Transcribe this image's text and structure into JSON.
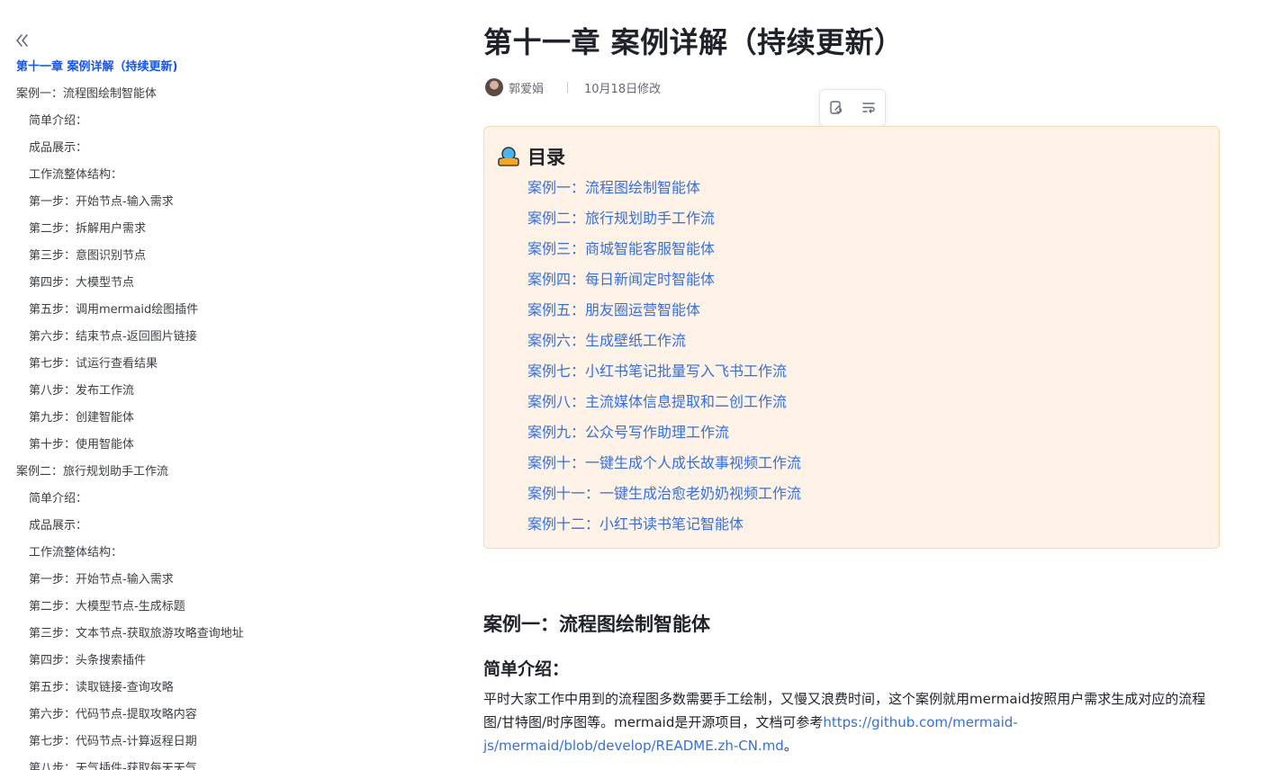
{
  "sidebar": {
    "items": [
      {
        "label": "第十一章 案例详解（持续更新)",
        "level": 1,
        "active": true
      },
      {
        "label": "案例一：流程图绘制智能体",
        "level": 1
      },
      {
        "label": "简单介绍：",
        "level": 2
      },
      {
        "label": "成品展示：",
        "level": 2
      },
      {
        "label": "工作流整体结构：",
        "level": 2
      },
      {
        "label": "第一步：开始节点-输入需求",
        "level": 2
      },
      {
        "label": "第二步：拆解用户需求",
        "level": 2
      },
      {
        "label": "第三步：意图识别节点",
        "level": 2
      },
      {
        "label": "第四步：大模型节点",
        "level": 2
      },
      {
        "label": "第五步：调用mermaid绘图插件",
        "level": 2
      },
      {
        "label": "第六步：结束节点-返回图片链接",
        "level": 2
      },
      {
        "label": "第七步：试运行查看结果",
        "level": 2
      },
      {
        "label": "第八步：发布工作流",
        "level": 2
      },
      {
        "label": "第九步：创建智能体",
        "level": 2
      },
      {
        "label": "第十步：使用智能体",
        "level": 2
      },
      {
        "label": "案例二：旅行规划助手工作流",
        "level": 1
      },
      {
        "label": "简单介绍：",
        "level": 2
      },
      {
        "label": "成品展示：",
        "level": 2
      },
      {
        "label": "工作流整体结构：",
        "level": 2
      },
      {
        "label": "第一步：开始节点-输入需求",
        "level": 2
      },
      {
        "label": "第二步：大模型节点-生成标题",
        "level": 2
      },
      {
        "label": "第三步：文本节点-获取旅游攻略查询地址",
        "level": 2
      },
      {
        "label": "第四步：头条搜索插件",
        "level": 2
      },
      {
        "label": "第五步：读取链接-查询攻略",
        "level": 2
      },
      {
        "label": "第六步：代码节点-提取攻略内容",
        "level": 2
      },
      {
        "label": "第七步：代码节点-计算返程日期",
        "level": 2
      },
      {
        "label": "第八步：天气插件-获取每天天气",
        "level": 2
      }
    ]
  },
  "doc": {
    "title": "第十一章 案例详解（持续更新）",
    "author": "郭爱娟",
    "modified": "10月18日修改"
  },
  "toc": {
    "title": "目录",
    "links": [
      "案例一：流程图绘制智能体",
      "案例二：旅行规划助手工作流",
      "案例三：商城智能客服智能体",
      "案例四：每日新闻定时智能体",
      "案例五：朋友圈运营智能体",
      "案例六：生成壁纸工作流",
      "案例七：小红书笔记批量写入飞书工作流",
      "案例八：主流媒体信息提取和二创工作流",
      "案例九：公众号写作助理工作流",
      "案例十：一键生成个人成长故事视频工作流",
      "案例十一：一键生成治愈老奶奶视频工作流",
      "案例十二：小红书读书笔记智能体"
    ]
  },
  "section": {
    "heading": "案例一：流程图绘制智能体",
    "subheading": "简单介绍：",
    "para_text": "平时大家工作中用到的流程图多数需要手工绘制，又慢又浪费时间，这个案例就用mermaid按照用户需求生成对应的流程图/甘特图/时序图等。mermaid是开源项目，文档可参考",
    "link": "https://github.com/mermaid-js/mermaid/blob/develop/README.zh-CN.md",
    "para_end": "。"
  },
  "icons": {
    "collapse": "double-chevron-left-icon",
    "copy_link": "link-copy-icon",
    "wrap": "text-wrap-icon",
    "toc": "person-badge-icon"
  },
  "colors": {
    "link": "#3370e0",
    "active": "#1456f0",
    "callout_bg": "#fef3e6",
    "callout_border": "#f8d9b0"
  }
}
